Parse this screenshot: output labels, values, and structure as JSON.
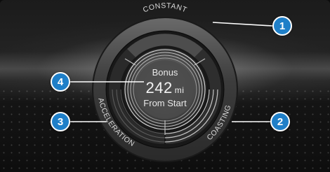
{
  "gauge": {
    "segments": {
      "top": "CONSTANT",
      "right": "COASTING",
      "left": "ACCELERATION"
    },
    "center": {
      "title": "Bonus",
      "value": "242",
      "unit": "mi",
      "subtitle": "From Start"
    }
  },
  "callouts": [
    {
      "number": "1",
      "target": "constant-segment"
    },
    {
      "number": "2",
      "target": "coasting-segment"
    },
    {
      "number": "3",
      "target": "acceleration-segment"
    },
    {
      "number": "4",
      "target": "bonus-readout"
    }
  ],
  "colors": {
    "callout": "#1f7fc8",
    "callout_border": "#ffffff"
  }
}
